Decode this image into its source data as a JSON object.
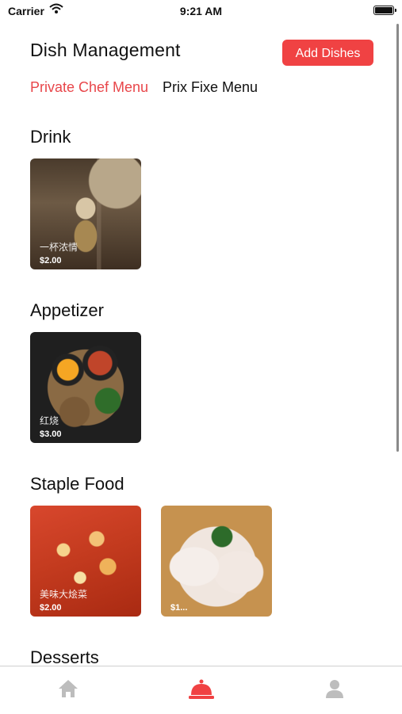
{
  "status_bar": {
    "carrier": "Carrier",
    "time": "9:21 AM"
  },
  "header": {
    "title": "Dish Management",
    "add_button": "Add Dishes"
  },
  "tabs": [
    {
      "label": "Private Chef Menu",
      "active": true
    },
    {
      "label": "Prix Fixe Menu",
      "active": false
    }
  ],
  "sections": [
    {
      "title": "Drink",
      "dishes": [
        {
          "name": "一杯浓情",
          "price": "$2.00"
        }
      ]
    },
    {
      "title": "Appetizer",
      "dishes": [
        {
          "name": "红烧",
          "price": "$3.00"
        }
      ]
    },
    {
      "title": "Staple Food",
      "dishes": [
        {
          "name": "美味大烩菜",
          "price": "$2.00"
        },
        {
          "name": "",
          "price": "$1..."
        }
      ]
    },
    {
      "title": "Desserts",
      "dishes": []
    }
  ],
  "tabbar": [
    {
      "icon": "home-icon",
      "active": false
    },
    {
      "icon": "service-bell-icon",
      "active": true
    },
    {
      "icon": "user-icon",
      "active": false
    }
  ],
  "colors": {
    "accent": "#f04243",
    "active_tab_text": "#e8464a",
    "inactive_icon": "#bdbdbd"
  }
}
